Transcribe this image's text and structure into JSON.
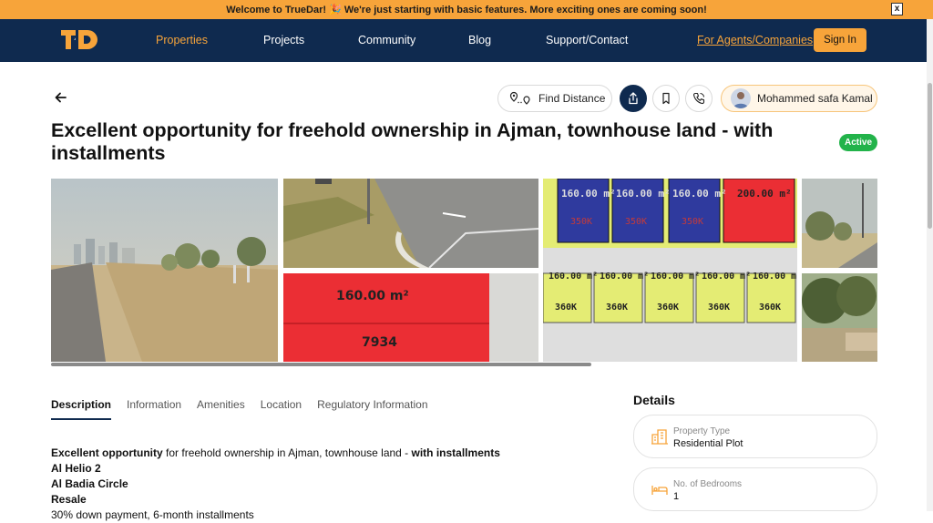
{
  "banner": {
    "text": "Welcome to TrueDar! 🎉 We're just starting with basic features. More exciting ones are coming soon!",
    "close": "x"
  },
  "nav": {
    "logo": "TD",
    "items": [
      "Properties",
      "Projects",
      "Community",
      "Blog",
      "Support/Contact"
    ],
    "agents": "For Agents/Companies",
    "signin": "Sign In"
  },
  "actions": {
    "find_distance": "Find Distance",
    "user_name": "Mohammed safa Kamal"
  },
  "listing": {
    "title": "Excellent opportunity for freehold ownership in Ajman, townhouse land - with installments",
    "status": "Active"
  },
  "gallery": {
    "plan_top": [
      "160.00 m²",
      "160.00 m²",
      "160.00 m²",
      "200.00 m²"
    ],
    "plan_top_price": [
      "350K",
      "350K",
      "350K",
      ""
    ],
    "plan_bottom": [
      "160.00 m²",
      "160.00 m²",
      "160.00 m²",
      "160.00 m²",
      "160.00 m²"
    ],
    "plan_bottom_price": [
      "360K",
      "360K",
      "360K",
      "360K",
      "360K"
    ],
    "red_plot_area": "160.00 m²",
    "red_plot_number": "7934"
  },
  "tabs": [
    "Description",
    "Information",
    "Amenities",
    "Location",
    "Regulatory Information"
  ],
  "description": {
    "line1_bold_a": "Excellent opportunity",
    "line1_mid": " for freehold ownership in Ajman, townhouse land - ",
    "line1_bold_b": "with installments",
    "line2": "Al Helio 2",
    "line3": "Al Badia Circle",
    "line4": "Resale",
    "line5": "30% down payment, 6-month installments"
  },
  "details": {
    "heading": "Details",
    "items": [
      {
        "label": "Property Type",
        "value": "Residential Plot",
        "icon": "building-icon"
      },
      {
        "label": "No. of Bedrooms",
        "value": "1",
        "icon": "bed-icon"
      }
    ]
  },
  "colors": {
    "navy": "#0f2a4f",
    "orange": "#f7a43a",
    "active": "#22b34a"
  }
}
